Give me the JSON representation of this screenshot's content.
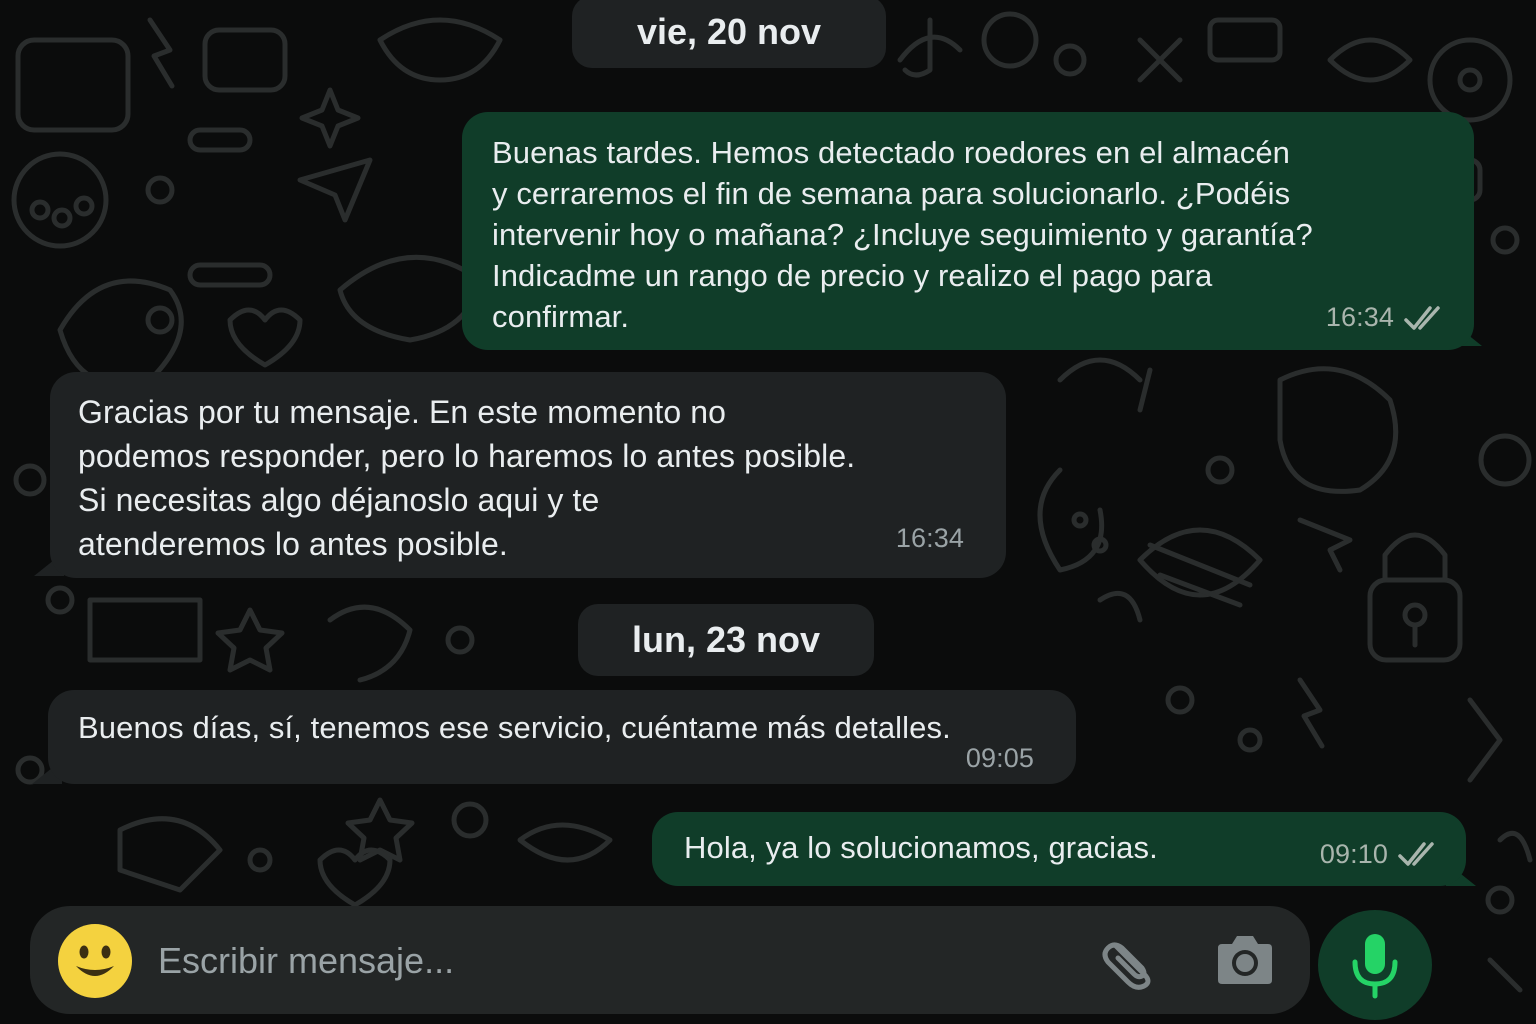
{
  "chat": {
    "date_separators": [
      {
        "label": "vie, 20 nov"
      },
      {
        "label": "lun, 23 nov"
      }
    ],
    "messages": [
      {
        "direction": "outgoing",
        "text": "Buenas tardes. Hemos detectado roedores en el almacén\ny cerraremos el fin de semana para solucionarlo. ¿Podéis\nintervenir hoy o mañana? ¿Incluye seguimiento y garantía?\nIndicadme un rango de precio y realizo el pago para\nconfirmar.",
        "time": "16:34",
        "status_icon": "double-check-icon"
      },
      {
        "direction": "incoming",
        "text": "Gracias por tu mensaje. En este momento no\npodemos responder, pero lo haremos lo antes posible.\nSi necesitas algo déjanoslo aqui y te\natenderemos lo antes posible.",
        "time": "16:34"
      },
      {
        "direction": "incoming",
        "text": "Buenos días, sí, tenemos ese servicio, cuéntame más detalles.",
        "time": "09:05"
      },
      {
        "direction": "outgoing",
        "text": "Hola, ya lo solucionamos, gracias.",
        "time": "09:10",
        "status_icon": "double-check-icon"
      }
    ]
  },
  "composer": {
    "placeholder": "Escribir mensaje...",
    "emoji_icon": "smiley-icon",
    "attach_icon": "paperclip-icon",
    "camera_icon": "camera-icon",
    "mic_icon": "microphone-icon"
  },
  "colors": {
    "background": "#0b0c0c",
    "outgoing_bubble": "#103d29",
    "incoming_bubble": "#1f2223",
    "accent": "#25d366",
    "text": "#e9edef"
  }
}
